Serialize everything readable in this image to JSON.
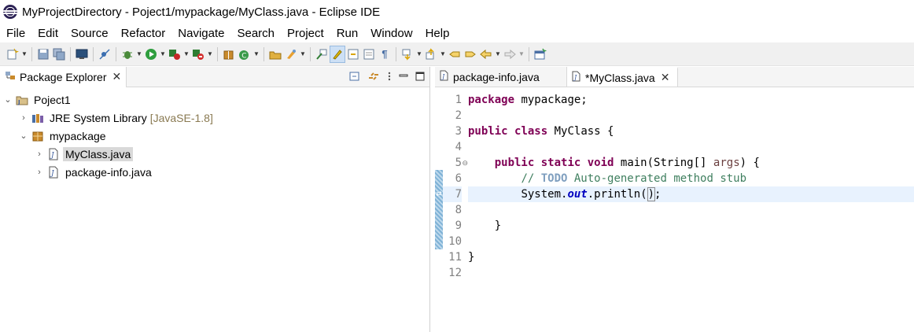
{
  "window": {
    "title": "MyProjectDirectory - Poject1/mypackage/MyClass.java - Eclipse IDE"
  },
  "menu": [
    "File",
    "Edit",
    "Source",
    "Refactor",
    "Navigate",
    "Search",
    "Project",
    "Run",
    "Window",
    "Help"
  ],
  "package_explorer": {
    "tab_label": "Package Explorer",
    "tree": {
      "project": "Poject1",
      "jre": "JRE System Library",
      "jre_version": "[JavaSE-1.8]",
      "package": "mypackage",
      "file1": "MyClass.java",
      "file2": "package-info.java"
    }
  },
  "editor": {
    "tabs": [
      "package-info.java",
      "*MyClass.java"
    ],
    "line_numbers": [
      "1",
      "2",
      "3",
      "4",
      "5",
      "6",
      "7",
      "8",
      "9",
      "10",
      "11",
      "12"
    ],
    "code": {
      "l1_kw": "package",
      "l1_rest": " mypackage;",
      "l3_kw1": "public",
      "l3_kw2": "class",
      "l3_rest": " MyClass {",
      "l5_kw1": "public",
      "l5_kw2": "static",
      "l5_kw3": "void",
      "l5_mid": " main(String[] ",
      "l5_param": "args",
      "l5_end": ") {",
      "l6_comment_start": "// ",
      "l6_todo": "TODO",
      "l6_comment_rest": " Auto-generated method stub",
      "l7_start": "System.",
      "l7_field": "out",
      "l7_call": ".println(",
      "l7_close": ")",
      "l7_end": ";",
      "l9": "}",
      "l11": "}"
    }
  },
  "colors": {
    "keyword": "#7f0055",
    "comment": "#3f7f5f",
    "todo": "#7f9fbf",
    "field": "#0000c0",
    "current_line": "#e8f2fe"
  }
}
